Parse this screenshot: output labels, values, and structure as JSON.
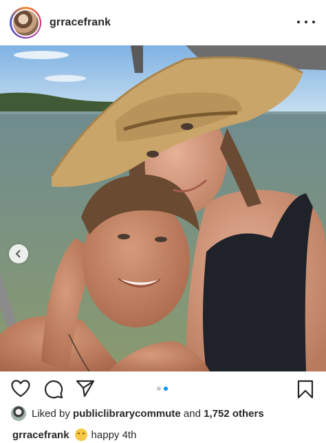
{
  "post": {
    "username": "grracefrank",
    "more_icon": "more-horizontal-icon",
    "photo_alt": "grracefrank"
  },
  "carousel": {
    "slide_count": 2,
    "active_index": 1
  },
  "actions": {
    "like_icon": "heart-icon",
    "comment_icon": "comment-icon",
    "share_icon": "send-icon",
    "save_icon": "bookmark-icon"
  },
  "likes": {
    "prefix": "Liked by",
    "liked_by_user": "publiclibrarycommute",
    "and": "and",
    "others": "1,752 others"
  },
  "caption": {
    "username": "grracefrank",
    "emoji": "smiling-face-icon",
    "text": "happy 4th"
  },
  "colors": {
    "accent": "#0095f6",
    "text": "#262626",
    "inactive_dot": "#c7c7c7"
  }
}
